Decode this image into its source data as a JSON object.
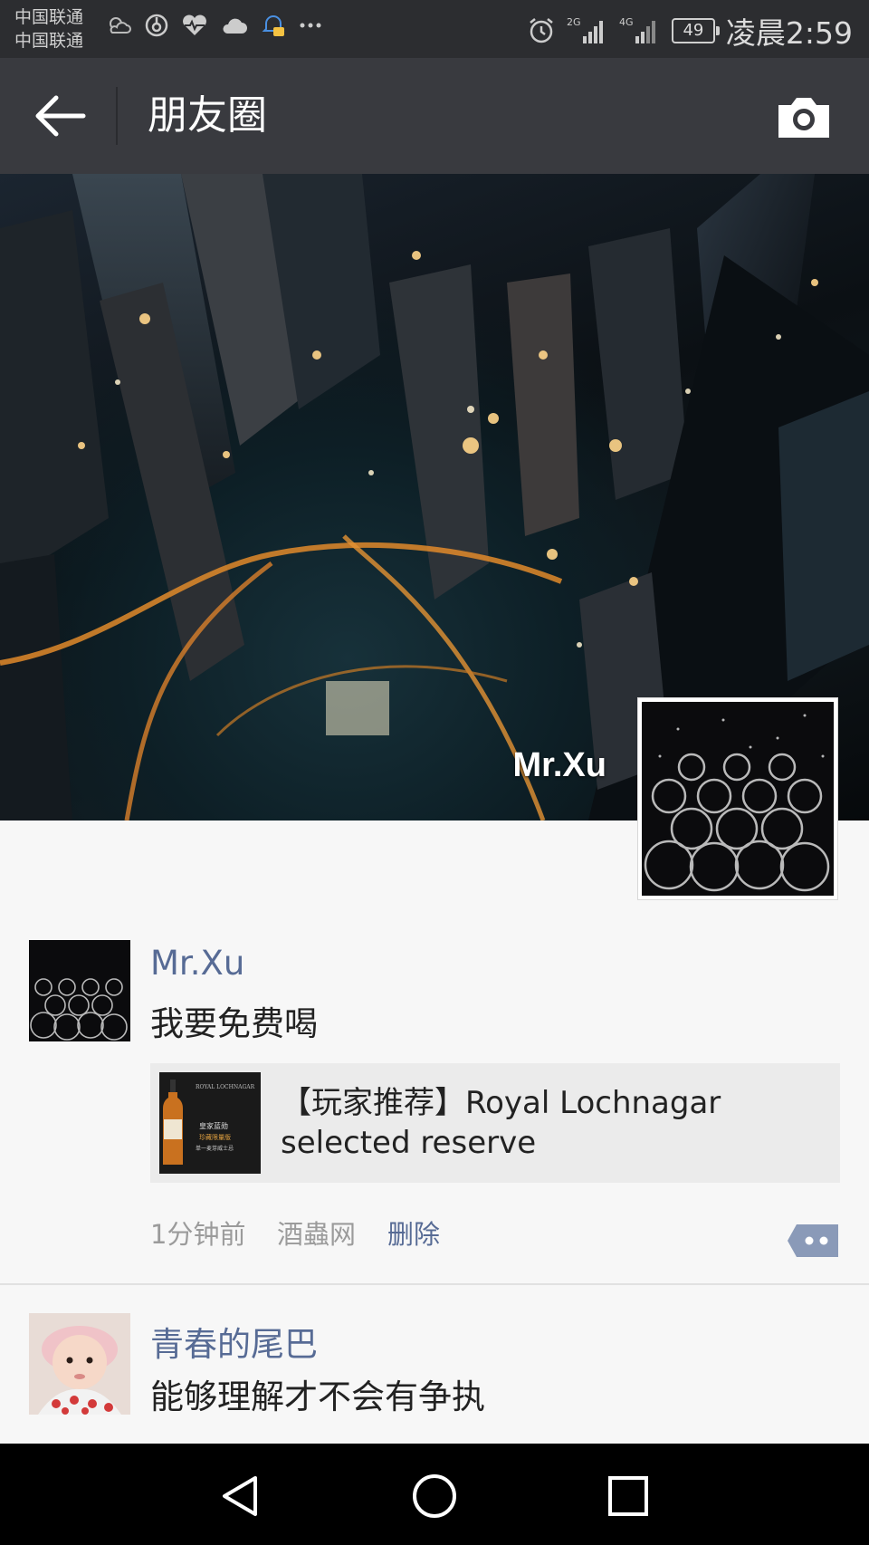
{
  "status_bar": {
    "carrier_1": "中国联通",
    "carrier_2": "中国联通",
    "network_1": "2G",
    "network_2": "4G",
    "battery": "49",
    "time": "凌晨2:59",
    "icons": [
      "weather-icon",
      "alipay-icon",
      "heart-rate-icon",
      "cloud-icon",
      "notification-icon",
      "more-icon",
      "alarm-icon",
      "signal-icon",
      "battery-icon"
    ]
  },
  "header": {
    "title": "朋友圈",
    "back_icon": "arrow-left-icon",
    "camera_icon": "camera-icon"
  },
  "cover": {
    "username": "Mr.Xu"
  },
  "posts": [
    {
      "name": "Mr.Xu",
      "text": "我要免费喝",
      "link": {
        "title": "【玩家推荐】Royal Lochnagar selected reserve",
        "thumb_text_1": "ROYAL LOCHNAGAR",
        "thumb_text_2": "皇家蓝勋",
        "thumb_text_3": "珍藏限量版",
        "thumb_text_4": "单一麦芽威士忌"
      },
      "time": "1分钟前",
      "source": "酒蟲网",
      "delete_label": "删除"
    },
    {
      "name": "青春的尾巴",
      "text": "能够理解才不会有争执"
    }
  ],
  "nav": [
    "back-triangle-icon",
    "home-circle-icon",
    "recents-square-icon"
  ],
  "colors": {
    "header_bg": "#393a3f",
    "status_bg": "#2c2d30",
    "link_name": "#576b95",
    "page_bg": "#f7f7f7"
  }
}
